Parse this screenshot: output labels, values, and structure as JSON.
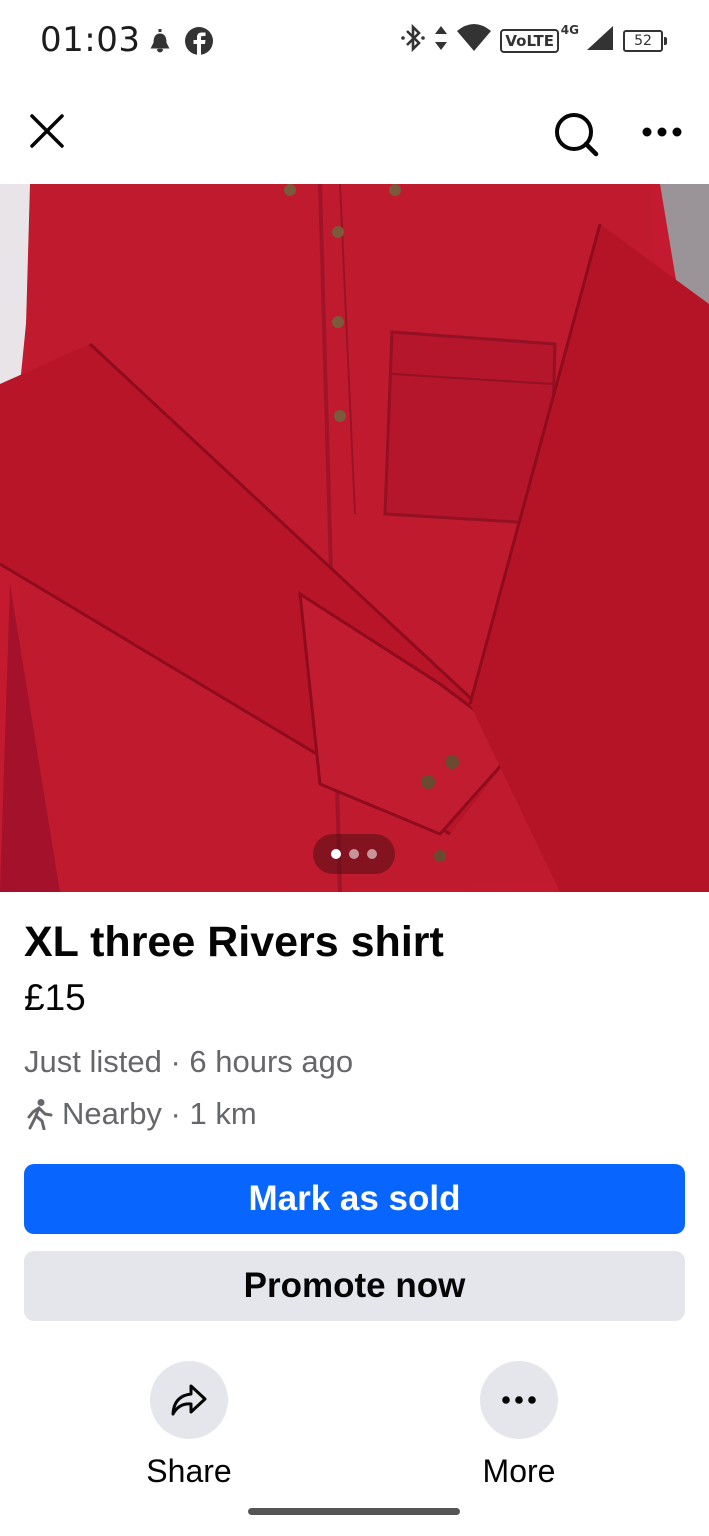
{
  "status_bar": {
    "time": "01:03",
    "network_label": "VoLTE",
    "network_type": "4G",
    "battery_level": "52",
    "icons": [
      "notification-icon",
      "facebook-icon",
      "bluetooth-icon",
      "data-arrows-icon",
      "wifi-icon",
      "signal-icon",
      "battery-icon"
    ]
  },
  "nav": {
    "icons": [
      "close-icon",
      "search-icon",
      "more-icon"
    ]
  },
  "photo": {
    "description_icon": "shirt-photo",
    "page_count": 3,
    "active_page": 1,
    "colors": {
      "shirt": "#b8142a",
      "shadow": "#8e0c1e"
    }
  },
  "listing": {
    "title": "XL three Rivers shirt",
    "price": "£15",
    "listed_text": "Just listed · 6 hours ago",
    "distance_text": "Nearby · 1 km"
  },
  "buttons": {
    "mark_sold": "Mark as sold",
    "promote": "Promote now"
  },
  "actions": {
    "share": "Share",
    "more": "More"
  },
  "colors": {
    "primary": "#0866ff",
    "secondary_bg": "#e4e6eb",
    "text": "#050505",
    "muted": "#65676b"
  }
}
